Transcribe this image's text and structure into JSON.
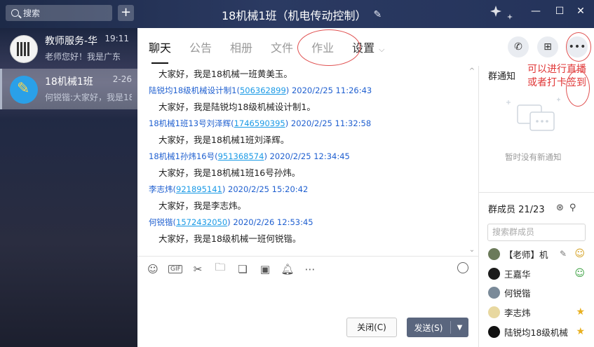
{
  "window": {
    "title": "18机械1班（机电传动控制）",
    "search_placeholder": "搜索"
  },
  "conversations": [
    {
      "name": "教师服务-华",
      "time": "19:11",
      "preview": "老师您好！我是广东",
      "avatar": "qr-icon"
    },
    {
      "name": "18机械1班",
      "time": "2-26",
      "preview": "何锐锴:大家好，我是18",
      "avatar": "pencil-icon"
    }
  ],
  "tabs": [
    {
      "label": "聊天",
      "active": true
    },
    {
      "label": "公告",
      "active": false
    },
    {
      "label": "相册",
      "active": false
    },
    {
      "label": "文件",
      "active": false
    },
    {
      "label": "作业",
      "active": false
    },
    {
      "label": "设置",
      "active": false
    }
  ],
  "messages": [
    {
      "meta_name": "",
      "meta_qq": "",
      "meta_time": "",
      "body": "大家好，我是18机械一班黄美玉。"
    },
    {
      "meta_name": "陆锐均18级机械设计制1(",
      "meta_qq": "506362899",
      "meta_time": ") 2020/2/25 11:26:43",
      "body": "大家好，我是陆锐均18级机械设计制1。"
    },
    {
      "meta_name": "18机械1班13号刘泽辉(",
      "meta_qq": "1746590395",
      "meta_time": ") 2020/2/25 11:32:58",
      "body": "大家好，我是18机械1班刘泽辉。"
    },
    {
      "meta_name": "18机械1孙炜16号(",
      "meta_qq": "951368574",
      "meta_time": ") 2020/2/25 12:34:45",
      "body": "大家好，我是18机械1班16号孙炜。"
    },
    {
      "meta_name": "李志炜(",
      "meta_qq": "921895141",
      "meta_time": ") 2020/2/25 15:20:42",
      "body": "大家好，我是李志炜。"
    },
    {
      "meta_name": "何锐锴(",
      "meta_qq": "1572432050",
      "meta_time": ") 2020/2/26 12:53:45",
      "body": "大家好，我是18级机械一班何锐锴。"
    }
  ],
  "toolbar": {
    "gif": "GIF"
  },
  "buttons": {
    "close": "关闭(C)",
    "send": "发送(S)"
  },
  "notice": {
    "title": "群通知",
    "empty": "暂时没有新通知",
    "annotation": "可以进行直播或者打卡签到"
  },
  "members": {
    "title": "群成员 21/23",
    "search_placeholder": "搜索群成员",
    "list": [
      {
        "name": "【老师】机",
        "role": "teacher",
        "color": "#6b7a5a"
      },
      {
        "name": "王嘉华",
        "role": "teacher",
        "color": "#1c1c1c"
      },
      {
        "name": "何锐锴",
        "role": "",
        "color": "#7a8a99"
      },
      {
        "name": "李志炜",
        "role": "admin",
        "color": "#e8d8a0"
      },
      {
        "name": "陆锐均18级机械",
        "role": "admin",
        "color": "#111111"
      }
    ]
  },
  "colors": {
    "accent_red": "#e03535",
    "link_blue": "#2060d0",
    "send_button": "#5a667e"
  }
}
